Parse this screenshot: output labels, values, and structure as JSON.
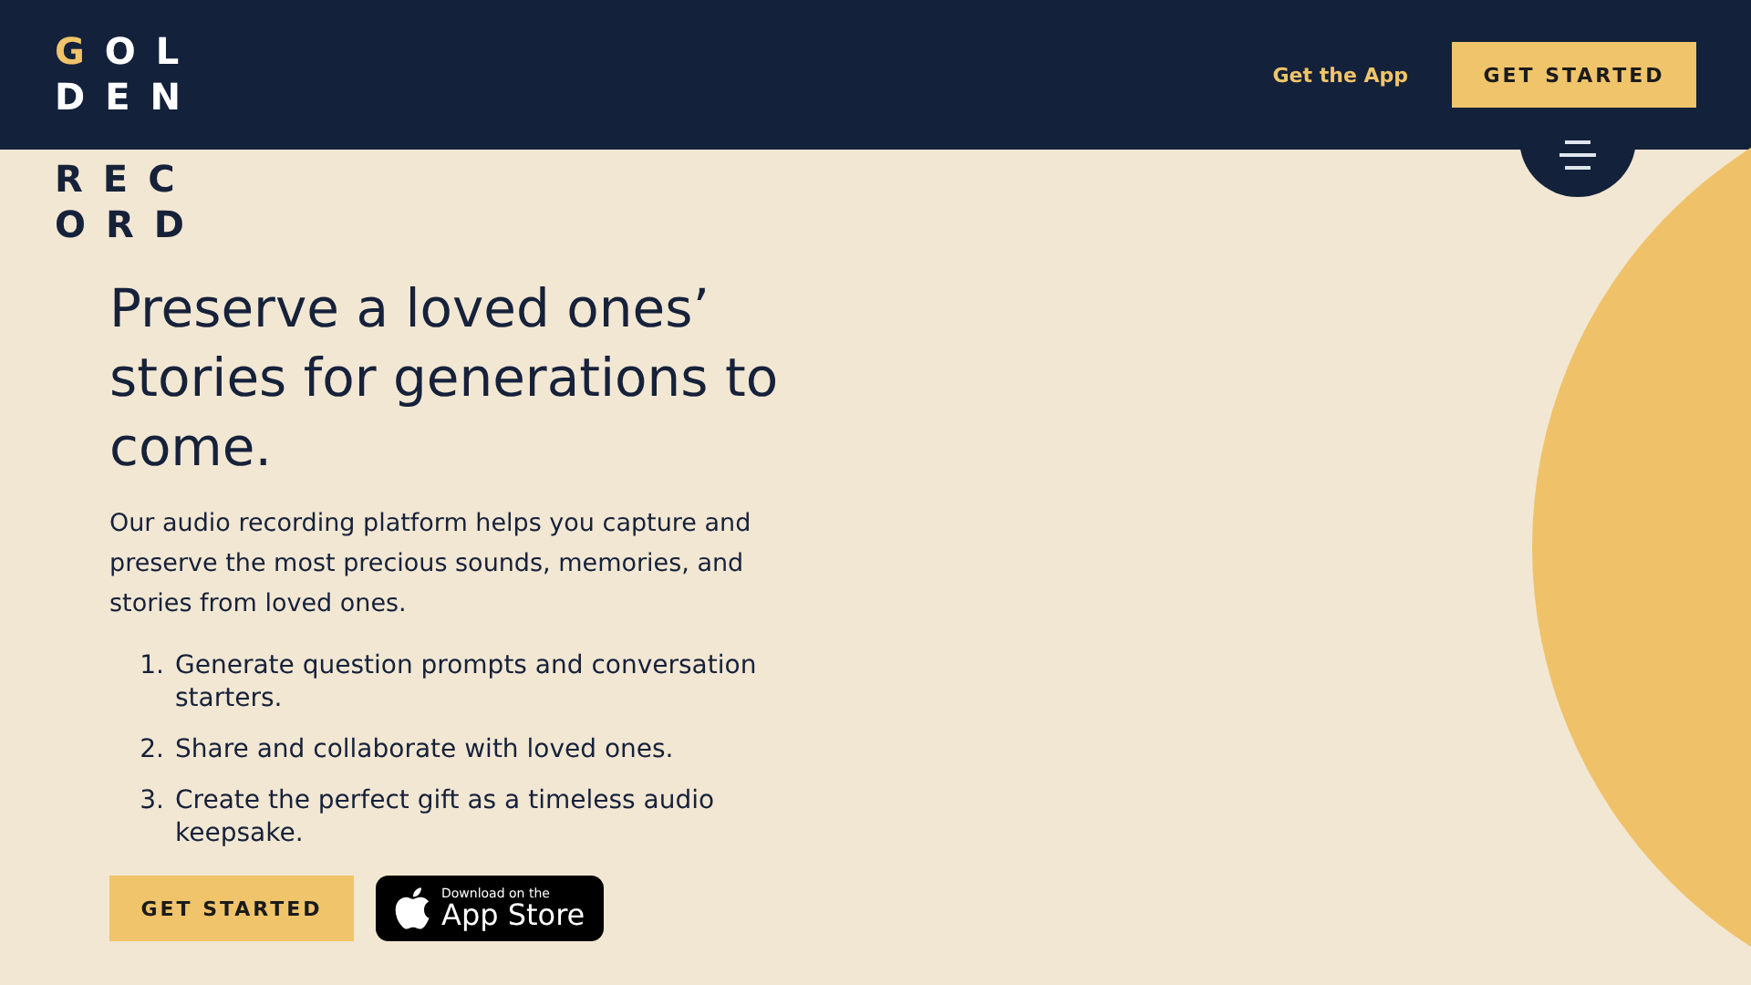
{
  "logo": {
    "rows": [
      {
        "accent": "G",
        "text": "OL"
      },
      {
        "accent": "",
        "text": "DEN"
      },
      {
        "accent": "",
        "text": "REC"
      },
      {
        "accent": "",
        "text": "ORD"
      }
    ]
  },
  "nav": {
    "link": "Get the App",
    "button": "GET STARTED"
  },
  "hero": {
    "heading": "Preserve a loved ones’ stories for generations to come.",
    "intro": "Our audio recording platform helps you capture and preserve the most precious sounds, memories, and stories from loved ones.",
    "steps": [
      {
        "number": "1.",
        "text": "Generate question prompts and conversation starters."
      },
      {
        "number": "2.",
        "text": "Share and collaborate with loved ones."
      },
      {
        "number": "3.",
        "text": "Create the perfect gift as a timeless audio keepsake."
      }
    ],
    "cta": "GET STARTED",
    "store_badge": {
      "small": "Download on the",
      "large": "App Store"
    }
  }
}
